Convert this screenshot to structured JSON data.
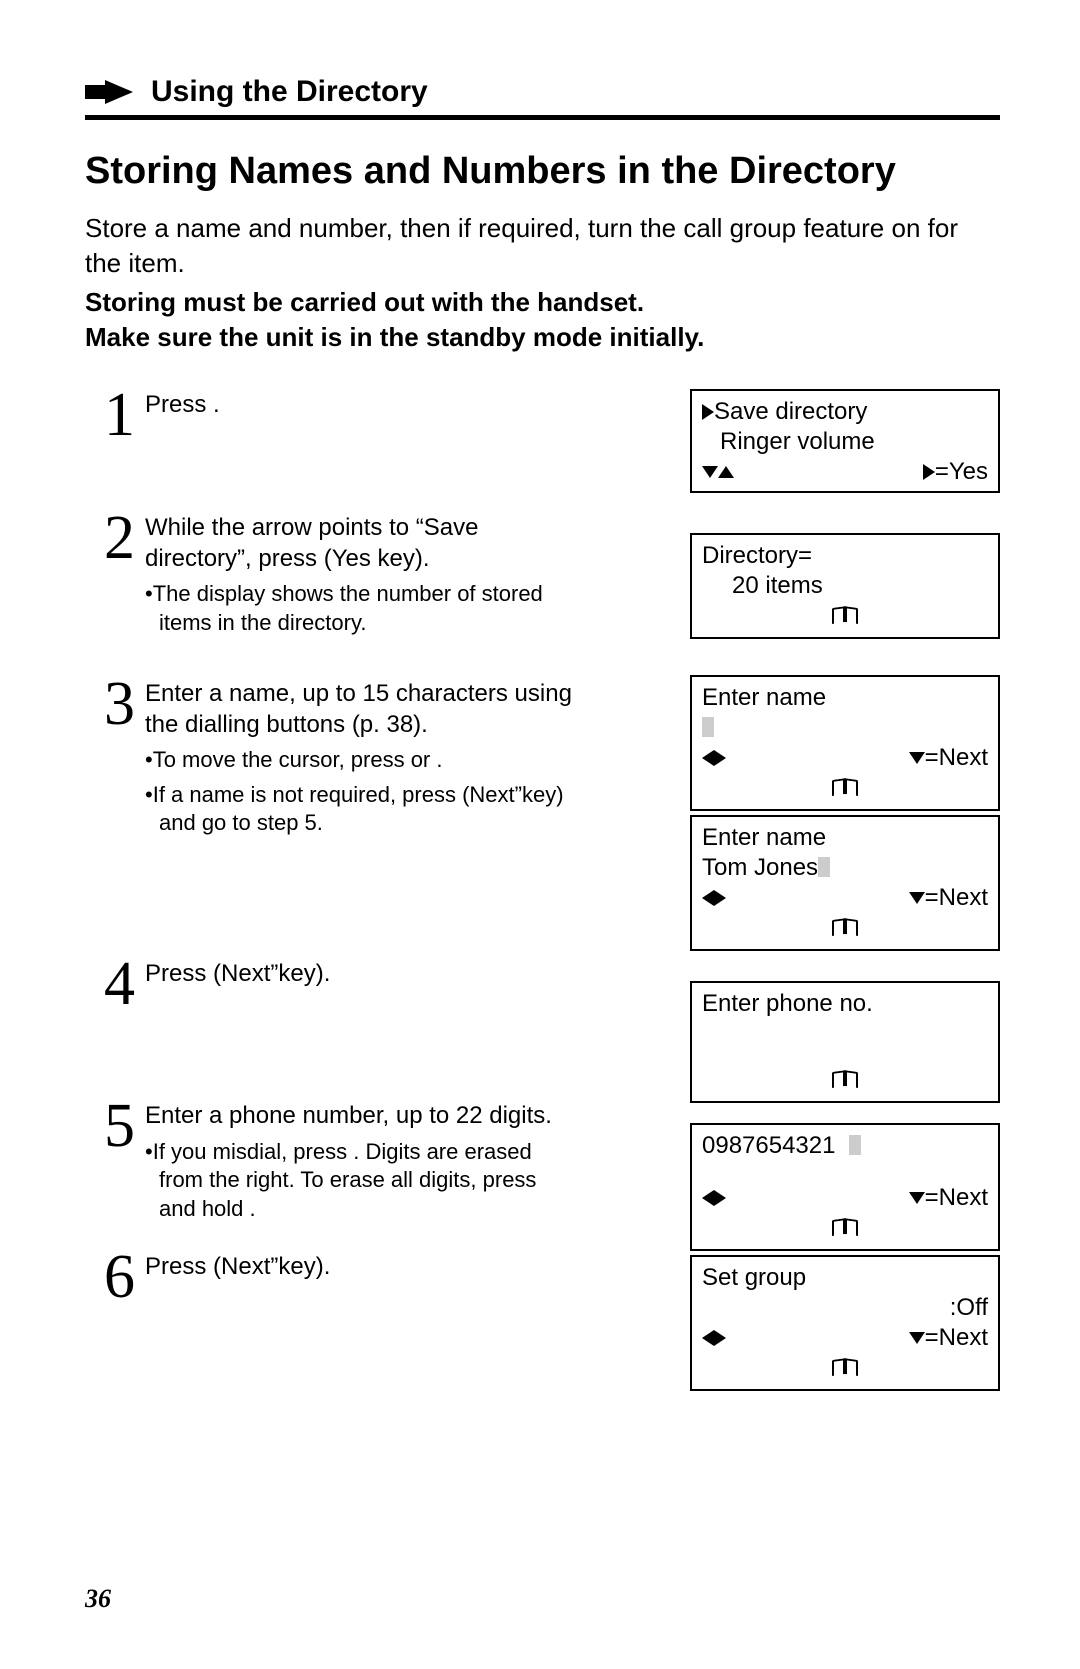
{
  "header": {
    "section_title": "Using the Directory"
  },
  "title": "Storing Names and Numbers in the Directory",
  "intro": "Store a name and number, then if required, turn the call group feature on for the item.",
  "intro_bold1": "Storing must be carried out with the handset.",
  "intro_bold2": "Make sure the unit is in the standby mode initially.",
  "steps": {
    "s1": {
      "num": "1",
      "text": "Press                             ."
    },
    "s2": {
      "num": "2",
      "text_a": "While the arrow points to “Save",
      "text_b": "directory”, press       (Yes key).",
      "sub1": "•The display shows the number of stored items in the directory."
    },
    "s3": {
      "num": "3",
      "text_a": "Enter a name, up to 15 characters using",
      "text_b": "the dialling buttons (p. 38).",
      "sub1": "•To move the cursor, press       or     .",
      "sub2": "•If a name is not required, press       (Next”key) and go to step 5."
    },
    "s4": {
      "num": "4",
      "text": "Press       (Next”key)."
    },
    "s5": {
      "num": "5",
      "text": "Enter a phone number, up to 22 digits.",
      "sub1": "•If you misdial, press               . Digits are erased from the right. To erase all digits, press and hold               ."
    },
    "s6": {
      "num": "6",
      "text": "Press       (Next”key)."
    }
  },
  "screens": {
    "sc1": {
      "l1": "Save directory",
      "l2": "Ringer volume",
      "r3": "=Yes"
    },
    "sc2": {
      "l1": "Directory=",
      "l2": "20 items"
    },
    "sc3": {
      "l1": "Enter name",
      "r3": "=Next"
    },
    "sc4": {
      "l1": "Enter name",
      "l2": "Tom Jones",
      "r3": "=Next"
    },
    "sc5": {
      "l1": "Enter phone no."
    },
    "sc6": {
      "l1": "0987654321",
      "r3": "=Next"
    },
    "sc7": {
      "l1": "Set group",
      "r2": ":Off",
      "r3": "=Next"
    }
  },
  "page_number": "36"
}
